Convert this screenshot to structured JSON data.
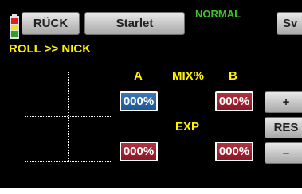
{
  "header": {
    "back_label": "RÜCK",
    "model_name": "Starlet",
    "flight_mode": "NORMAL",
    "save_label": "Sv"
  },
  "screen_title": "ROLL >> NICK",
  "battery": {
    "cell_colors": [
      "#e21c1c",
      "#f2e21a",
      "#2ba02b"
    ]
  },
  "mix": {
    "col_a_label": "A",
    "mix_label": "MIX%",
    "col_b_label": "B",
    "exp_label": "EXP",
    "mix_a_value": "000%",
    "mix_b_value": "000%",
    "exp_a_value": "000%",
    "exp_b_value": "000%"
  },
  "controls": {
    "plus_label": "+",
    "reset_label": "RES",
    "minus_label": "–"
  },
  "colors": {
    "background": "#000000",
    "label_yellow": "#fff200",
    "mode_green": "#3ec12c",
    "field_selected_blue": "#2a64a8",
    "field_red": "#9c1f30"
  }
}
